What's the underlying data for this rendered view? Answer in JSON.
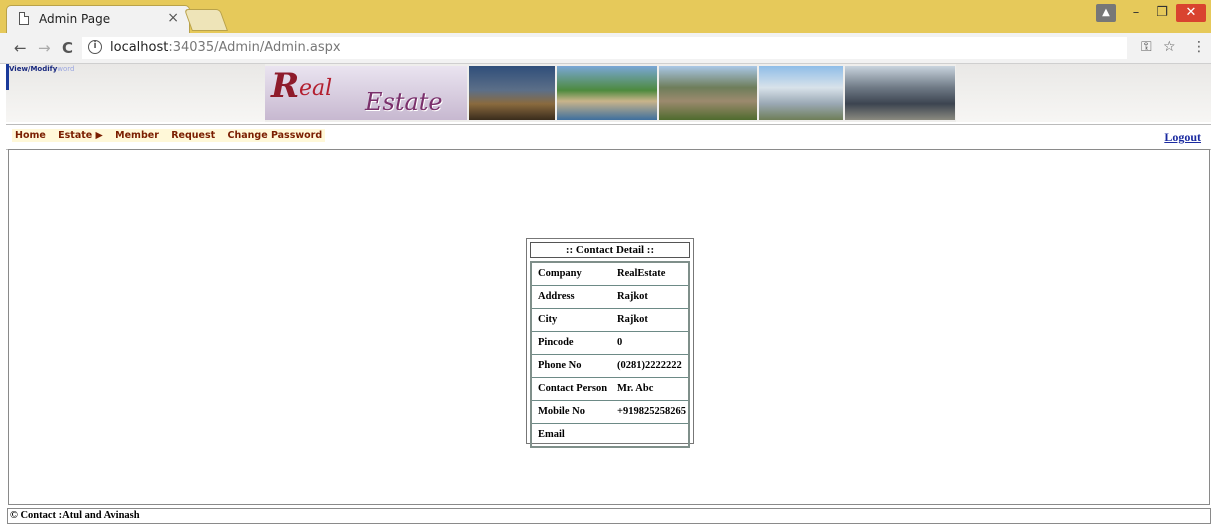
{
  "browser": {
    "tab_title": "Admin Page",
    "tab_close": "×",
    "url_host": "localhost",
    "url_path": ":34035/Admin/Admin.aspx",
    "window_controls": {
      "user": "▲",
      "minimize": "–",
      "maximize": "❐",
      "close": "✕"
    },
    "nav": {
      "back": "←",
      "forward": "→",
      "reload": "C"
    },
    "toolbar_icons": {
      "key": "⚿",
      "star": "☆",
      "menu": "⋮"
    }
  },
  "header": {
    "corner_link_main": "View/Modify",
    "corner_link_faded": "word",
    "logo_R": "R",
    "logo_eal": "eal",
    "logo_estate": "Estate"
  },
  "menu": {
    "items": [
      "Home",
      "Estate ▶",
      "Member",
      "Request",
      "Change Password"
    ],
    "logout": "Logout"
  },
  "contact": {
    "title": ":: Contact Detail ::",
    "rows": [
      {
        "label": "Company",
        "value": "RealEstate"
      },
      {
        "label": "Address",
        "value": "Rajkot"
      },
      {
        "label": "City",
        "value": "Rajkot"
      },
      {
        "label": "Pincode",
        "value": "0"
      },
      {
        "label": "Phone No",
        "value": "(0281)2222222"
      },
      {
        "label": "Contact Person",
        "value": "Mr. Abc"
      },
      {
        "label": "Mobile No",
        "value": "+919825258265"
      },
      {
        "label": "Email",
        "value": ""
      }
    ]
  },
  "footer": {
    "text": "© Contact :Atul and Avinash"
  },
  "colors": {
    "tabstrip": "#e6c95a",
    "menu_text": "#7a1e00",
    "menu_bg": "#fff8d8",
    "link": "#1a2aa0",
    "window_close": "#d9432f"
  }
}
